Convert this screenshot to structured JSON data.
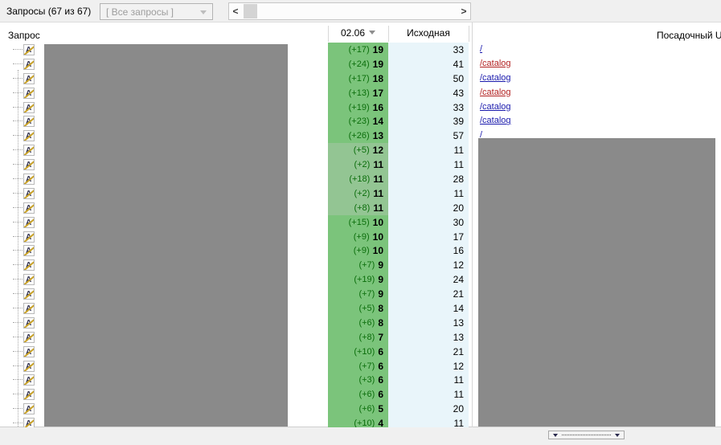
{
  "topbar": {
    "queries_label": "Запросы (67 из 67)",
    "filter_value": "[ Все запросы ]",
    "scroll_left": "<",
    "scroll_right": ">"
  },
  "table": {
    "headers": {
      "query": "Запрос",
      "date": "02.06",
      "initial": "Исходная",
      "landing_url": "Посадочный URL"
    },
    "keyword_icon_glyph": "A",
    "rows": [
      {
        "change": "(+17)",
        "position": "19",
        "initial": "33",
        "url": "/",
        "url_color": "blue",
        "shade": "vivid"
      },
      {
        "change": "(+24)",
        "position": "19",
        "initial": "41",
        "url": "/catalog",
        "url_color": "red",
        "shade": "vivid"
      },
      {
        "change": "(+17)",
        "position": "18",
        "initial": "50",
        "url": "/catalog",
        "url_color": "blue",
        "shade": "vivid"
      },
      {
        "change": "(+13)",
        "position": "17",
        "initial": "43",
        "url": "/catalog",
        "url_color": "red",
        "shade": "vivid"
      },
      {
        "change": "(+19)",
        "position": "16",
        "initial": "33",
        "url": "/catalog",
        "url_color": "blue",
        "shade": "vivid"
      },
      {
        "change": "(+23)",
        "position": "14",
        "initial": "39",
        "url": "/catalog",
        "url_color": "blue",
        "shade": "vivid"
      },
      {
        "change": "(+26)",
        "position": "13",
        "initial": "57",
        "url": "/",
        "url_color": "blue",
        "shade": "vivid"
      },
      {
        "change": "(+5)",
        "position": "12",
        "initial": "11",
        "shade": "muted"
      },
      {
        "change": "(+2)",
        "position": "11",
        "initial": "11",
        "shade": "muted"
      },
      {
        "change": "(+18)",
        "position": "11",
        "initial": "28",
        "shade": "muted"
      },
      {
        "change": "(+2)",
        "position": "11",
        "initial": "11",
        "shade": "muted"
      },
      {
        "change": "(+8)",
        "position": "11",
        "initial": "20",
        "shade": "muted"
      },
      {
        "change": "(+15)",
        "position": "10",
        "initial": "30",
        "shade": "vivid"
      },
      {
        "change": "(+9)",
        "position": "10",
        "initial": "17",
        "shade": "vivid"
      },
      {
        "change": "(+9)",
        "position": "10",
        "initial": "16",
        "shade": "vivid"
      },
      {
        "change": "(+7)",
        "position": "9",
        "initial": "12",
        "shade": "vivid"
      },
      {
        "change": "(+19)",
        "position": "9",
        "initial": "24",
        "shade": "vivid"
      },
      {
        "change": "(+7)",
        "position": "9",
        "initial": "21",
        "shade": "vivid"
      },
      {
        "change": "(+5)",
        "position": "8",
        "initial": "14",
        "shade": "vivid"
      },
      {
        "change": "(+6)",
        "position": "8",
        "initial": "13",
        "shade": "vivid"
      },
      {
        "change": "(+8)",
        "position": "7",
        "initial": "13",
        "shade": "vivid"
      },
      {
        "change": "(+10)",
        "position": "6",
        "initial": "21",
        "shade": "vivid"
      },
      {
        "change": "(+7)",
        "position": "6",
        "initial": "12",
        "shade": "vivid"
      },
      {
        "change": "(+3)",
        "position": "6",
        "initial": "11",
        "shade": "vivid"
      },
      {
        "change": "(+6)",
        "position": "6",
        "initial": "11",
        "shade": "vivid"
      },
      {
        "change": "(+6)",
        "position": "5",
        "initial": "20",
        "shade": "vivid"
      },
      {
        "change": "(+10)",
        "position": "4",
        "initial": "11",
        "shade": "vivid"
      }
    ]
  },
  "colors": {
    "green_vivid": "#7bc47b",
    "green_muted": "#93c593",
    "change_text": "#0b6d0b",
    "initial_bg": "#e9f5fa",
    "link_blue": "#1a1aad",
    "link_red": "#b22222",
    "redaction_gray": "#8a8a8a"
  }
}
